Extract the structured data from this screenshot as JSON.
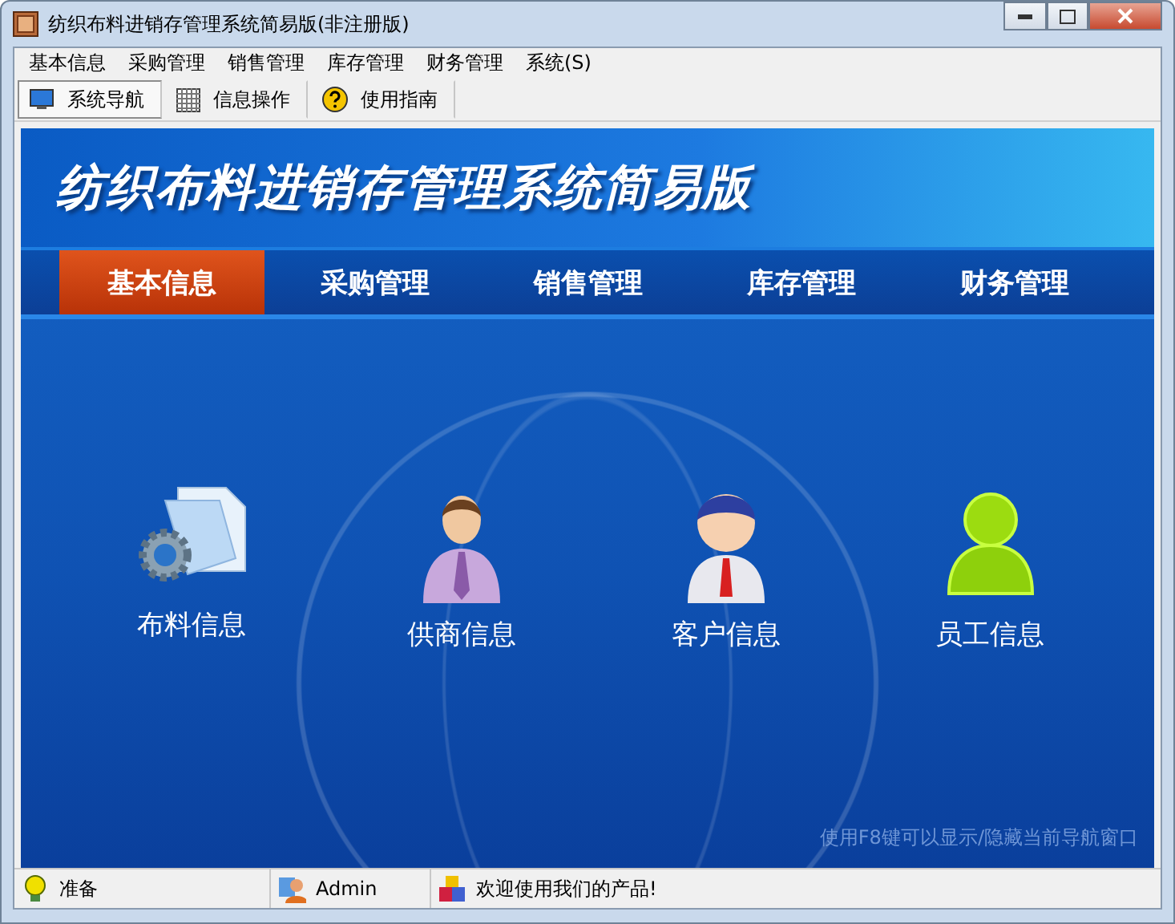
{
  "window": {
    "title": "纺织布料进销存管理系统简易版(非注册版)"
  },
  "menu": [
    "基本信息",
    "采购管理",
    "销售管理",
    "库存管理",
    "财务管理",
    "系统(S)"
  ],
  "toolbar": [
    {
      "label": "系统导航",
      "selected": true,
      "kind": "monitor"
    },
    {
      "label": "信息操作",
      "selected": false,
      "kind": "grid"
    },
    {
      "label": "使用指南",
      "selected": false,
      "kind": "help"
    }
  ],
  "banner": {
    "title": "纺织布料进销存管理系统简易版"
  },
  "nav_tabs": [
    {
      "label": "基本信息",
      "selected": true
    },
    {
      "label": "采购管理",
      "selected": false
    },
    {
      "label": "销售管理",
      "selected": false
    },
    {
      "label": "库存管理",
      "selected": false
    },
    {
      "label": "财务管理",
      "selected": false
    }
  ],
  "modules": [
    {
      "label": "布料信息",
      "kind": "document"
    },
    {
      "label": "供商信息",
      "kind": "supplier"
    },
    {
      "label": "客户信息",
      "kind": "customer"
    },
    {
      "label": "员工信息",
      "kind": "staff"
    }
  ],
  "hint": "使用F8键可以显示/隐藏当前导航窗口",
  "status_bar": [
    {
      "text": "准备",
      "kind": "ready"
    },
    {
      "text": "Admin",
      "kind": "user"
    },
    {
      "text": "欢迎使用我们的产品!",
      "kind": "product"
    }
  ]
}
